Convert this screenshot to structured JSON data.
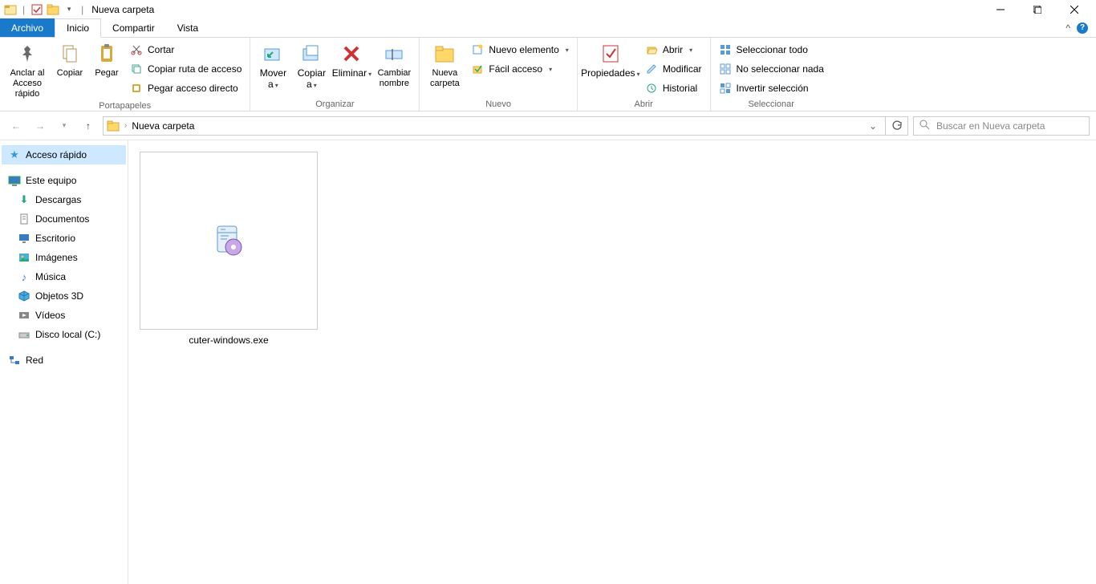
{
  "title": "Nueva carpeta",
  "tabs": {
    "file": "Archivo",
    "home": "Inicio",
    "share": "Compartir",
    "view": "Vista"
  },
  "ribbon": {
    "clipboard": {
      "label": "Portapapeles",
      "pin": "Anclar al Acceso rápido",
      "copy": "Copiar",
      "paste": "Pegar",
      "cut": "Cortar",
      "copy_path": "Copiar ruta de acceso",
      "paste_shortcut": "Pegar acceso directo"
    },
    "organize": {
      "label": "Organizar",
      "move": "Mover a",
      "copy_to": "Copiar a",
      "delete": "Eliminar",
      "rename": "Cambiar nombre"
    },
    "new": {
      "label": "Nuevo",
      "new_folder": "Nueva carpeta",
      "new_item": "Nuevo elemento",
      "easy_access": "Fácil acceso"
    },
    "open": {
      "label": "Abrir",
      "properties": "Propiedades",
      "open": "Abrir",
      "edit": "Modificar",
      "history": "Historial"
    },
    "select": {
      "label": "Seleccionar",
      "select_all": "Seleccionar todo",
      "select_none": "No seleccionar nada",
      "invert": "Invertir selección"
    }
  },
  "breadcrumb": {
    "current": "Nueva carpeta"
  },
  "search": {
    "placeholder": "Buscar en Nueva carpeta"
  },
  "nav": {
    "quick_access": "Acceso rápido",
    "this_pc": "Este equipo",
    "downloads": "Descargas",
    "documents": "Documentos",
    "desktop": "Escritorio",
    "pictures": "Imágenes",
    "music": "Música",
    "objects3d": "Objetos 3D",
    "videos": "Vídeos",
    "local_disk": "Disco local (C:)",
    "network": "Red"
  },
  "files": [
    {
      "name": "cuter-windows.exe"
    }
  ]
}
